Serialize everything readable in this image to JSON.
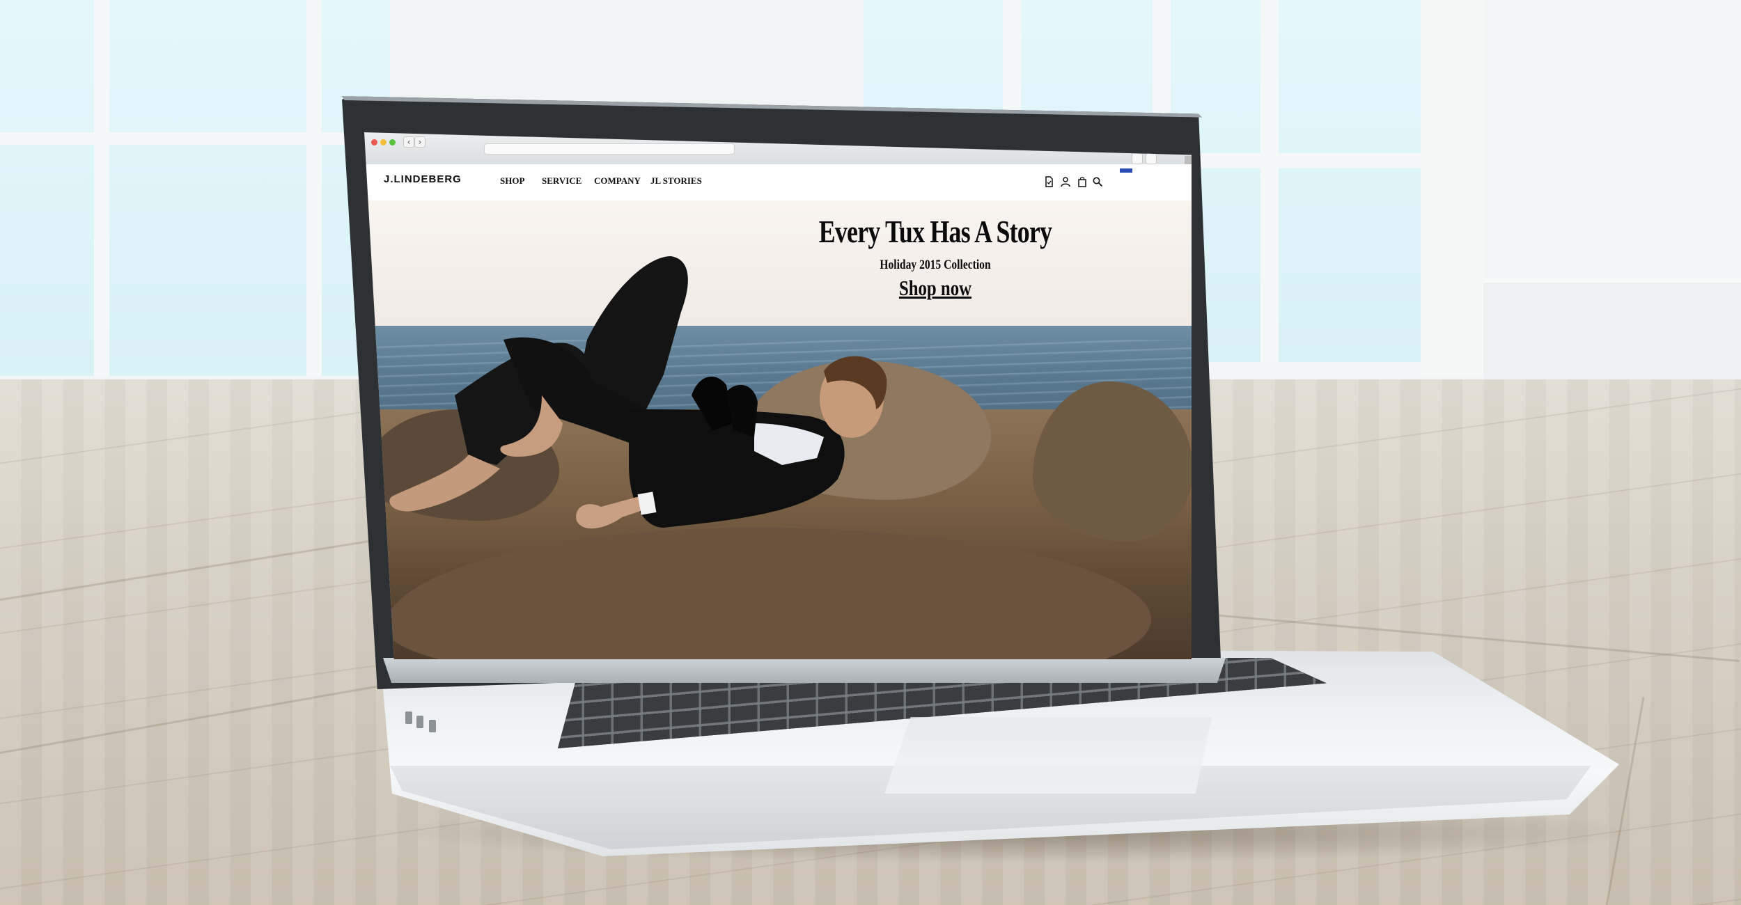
{
  "site": {
    "brand": "J.LINDEBERG",
    "nav": [
      "SHOP",
      "SERVICE",
      "COMPANY",
      "JL STORIES"
    ]
  },
  "hero": {
    "headline": "Every Tux Has A Story",
    "subtitle": "Holiday 2015 Collection",
    "cta": "Shop now"
  },
  "header_icons": [
    "wishlist-icon",
    "account-icon",
    "bag-icon",
    "search-icon"
  ],
  "colors": {
    "brand_text": "#111111",
    "header_bg": "#ffffff",
    "language_flag": "#2b4cb5"
  }
}
